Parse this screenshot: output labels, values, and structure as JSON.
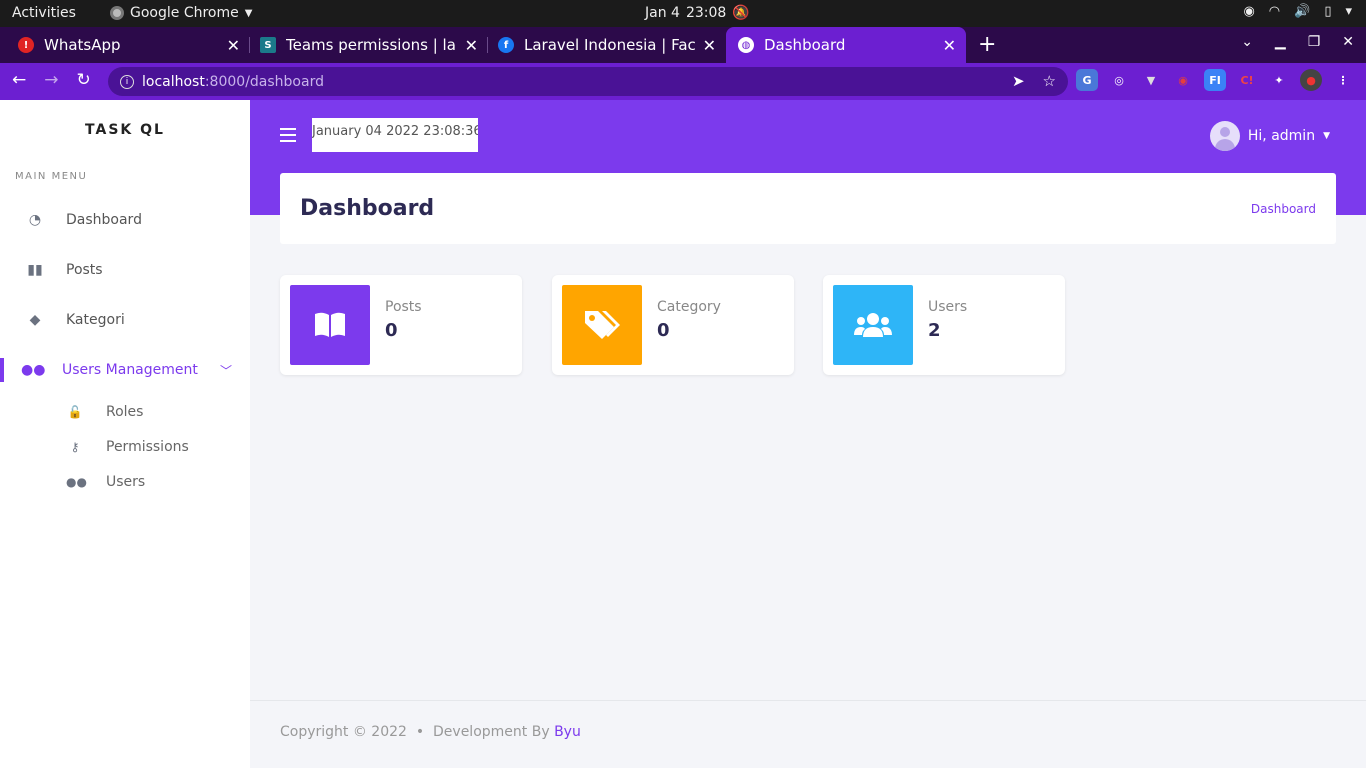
{
  "system": {
    "activities": "Activities",
    "app_name": "Google Chrome",
    "date": "Jan 4",
    "time": "23:08"
  },
  "browser": {
    "tabs": [
      {
        "title": "WhatsApp",
        "favicon": "whatsapp-alert-icon"
      },
      {
        "title": "Teams permissions | larav",
        "favicon": "s-site-icon"
      },
      {
        "title": "Laravel Indonesia | Facebo",
        "favicon": "facebook-icon"
      },
      {
        "title": "Dashboard",
        "favicon": "globe-icon"
      }
    ],
    "url_host": "localhost",
    "url_path": ":8000/dashboard"
  },
  "sidebar": {
    "brand": "TASK QL",
    "menu_header": "MAIN MENU",
    "items": [
      {
        "label": "Dashboard",
        "icon": "gauge-icon"
      },
      {
        "label": "Posts",
        "icon": "book-icon"
      },
      {
        "label": "Kategori",
        "icon": "tag-icon"
      },
      {
        "label": "Users Management",
        "icon": "users-icon"
      }
    ],
    "subitems": [
      {
        "label": "Roles",
        "icon": "unlock-icon"
      },
      {
        "label": "Permissions",
        "icon": "key-icon"
      },
      {
        "label": "Users",
        "icon": "users-icon"
      }
    ]
  },
  "header": {
    "datetime": "January 04 2022 23:08:36",
    "greeting": "Hi, admin"
  },
  "page": {
    "title": "Dashboard",
    "breadcrumb": "Dashboard"
  },
  "stats": [
    {
      "label": "Posts",
      "value": "0",
      "color": "#7c3aed",
      "icon": "book-open-icon"
    },
    {
      "label": "Category",
      "value": "0",
      "color": "#ffa500",
      "icon": "tags-icon"
    },
    {
      "label": "Users",
      "value": "2",
      "color": "#2eb5f7",
      "icon": "users-icon"
    }
  ],
  "footer": {
    "copyright": "Copyright © 2022",
    "separator": "•",
    "dev_prefix": "Development By",
    "author": "Byu"
  },
  "colors": {
    "primary": "#7c3aed",
    "tab_strip": "#2c0a4a",
    "chrome_accent": "#6c1fd1"
  }
}
